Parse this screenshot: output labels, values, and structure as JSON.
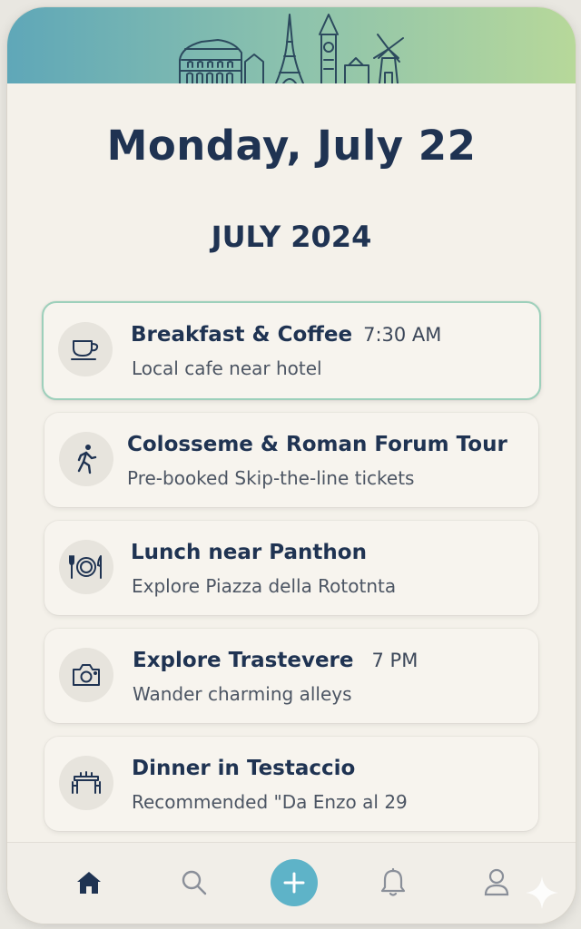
{
  "header": {
    "date_title": "Monday, July 22",
    "month_title": "JULY 2024",
    "banner_illustration": "european-landmarks-skyline"
  },
  "itinerary": [
    {
      "title": "Breakfast & Coffee",
      "time": "7:30 AM",
      "subtitle": "Local cafe near hotel",
      "icon": "coffee-cup-icon",
      "active": true
    },
    {
      "title": "Colosseme & Roman Forum Tour",
      "time": "",
      "subtitle": "Pre-booked Skip-the-line tickets",
      "icon": "walking-person-icon",
      "active": false
    },
    {
      "title": "Lunch near Panthon",
      "time": "",
      "subtitle": "Explore Piazza della Rototnta",
      "icon": "plate-cutlery-icon",
      "active": false
    },
    {
      "title": "Explore Trastevere",
      "time": "7 PM",
      "subtitle": "Wander charming alleys",
      "icon": "camera-icon",
      "active": false
    },
    {
      "title": "Dinner in Testaccio",
      "time": "",
      "subtitle": "Recommended \"Da Enzo al 29",
      "icon": "restaurant-table-icon",
      "active": false
    }
  ],
  "nav": {
    "items": [
      "home-icon",
      "search-icon",
      "add-icon",
      "bell-icon",
      "profile-icon"
    ],
    "active": "home-icon"
  },
  "colors": {
    "primary_text": "#1f3352",
    "accent": "#5eb3c8",
    "active_border": "#9dd0bb",
    "background": "#f4f1ea"
  }
}
